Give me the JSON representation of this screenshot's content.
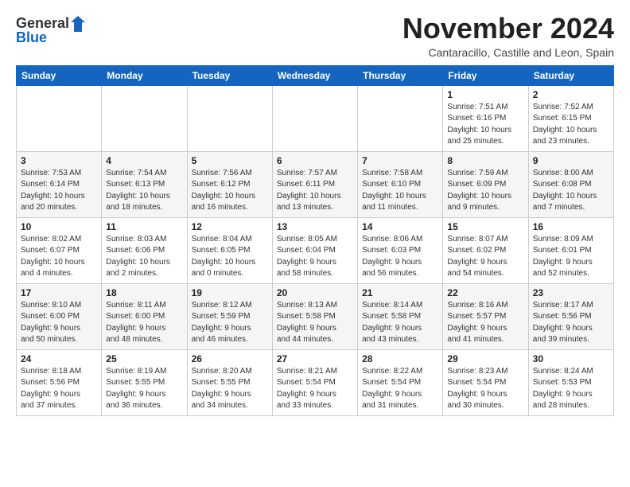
{
  "logo": {
    "general": "General",
    "blue": "Blue"
  },
  "header": {
    "month": "November 2024",
    "location": "Cantaracillo, Castille and Leon, Spain"
  },
  "weekdays": [
    "Sunday",
    "Monday",
    "Tuesday",
    "Wednesday",
    "Thursday",
    "Friday",
    "Saturday"
  ],
  "weeks": [
    [
      {
        "day": "",
        "info": ""
      },
      {
        "day": "",
        "info": ""
      },
      {
        "day": "",
        "info": ""
      },
      {
        "day": "",
        "info": ""
      },
      {
        "day": "",
        "info": ""
      },
      {
        "day": "1",
        "info": "Sunrise: 7:51 AM\nSunset: 6:16 PM\nDaylight: 10 hours\nand 25 minutes."
      },
      {
        "day": "2",
        "info": "Sunrise: 7:52 AM\nSunset: 6:15 PM\nDaylight: 10 hours\nand 23 minutes."
      }
    ],
    [
      {
        "day": "3",
        "info": "Sunrise: 7:53 AM\nSunset: 6:14 PM\nDaylight: 10 hours\nand 20 minutes."
      },
      {
        "day": "4",
        "info": "Sunrise: 7:54 AM\nSunset: 6:13 PM\nDaylight: 10 hours\nand 18 minutes."
      },
      {
        "day": "5",
        "info": "Sunrise: 7:56 AM\nSunset: 6:12 PM\nDaylight: 10 hours\nand 16 minutes."
      },
      {
        "day": "6",
        "info": "Sunrise: 7:57 AM\nSunset: 6:11 PM\nDaylight: 10 hours\nand 13 minutes."
      },
      {
        "day": "7",
        "info": "Sunrise: 7:58 AM\nSunset: 6:10 PM\nDaylight: 10 hours\nand 11 minutes."
      },
      {
        "day": "8",
        "info": "Sunrise: 7:59 AM\nSunset: 6:09 PM\nDaylight: 10 hours\nand 9 minutes."
      },
      {
        "day": "9",
        "info": "Sunrise: 8:00 AM\nSunset: 6:08 PM\nDaylight: 10 hours\nand 7 minutes."
      }
    ],
    [
      {
        "day": "10",
        "info": "Sunrise: 8:02 AM\nSunset: 6:07 PM\nDaylight: 10 hours\nand 4 minutes."
      },
      {
        "day": "11",
        "info": "Sunrise: 8:03 AM\nSunset: 6:06 PM\nDaylight: 10 hours\nand 2 minutes."
      },
      {
        "day": "12",
        "info": "Sunrise: 8:04 AM\nSunset: 6:05 PM\nDaylight: 10 hours\nand 0 minutes."
      },
      {
        "day": "13",
        "info": "Sunrise: 8:05 AM\nSunset: 6:04 PM\nDaylight: 9 hours\nand 58 minutes."
      },
      {
        "day": "14",
        "info": "Sunrise: 8:06 AM\nSunset: 6:03 PM\nDaylight: 9 hours\nand 56 minutes."
      },
      {
        "day": "15",
        "info": "Sunrise: 8:07 AM\nSunset: 6:02 PM\nDaylight: 9 hours\nand 54 minutes."
      },
      {
        "day": "16",
        "info": "Sunrise: 8:09 AM\nSunset: 6:01 PM\nDaylight: 9 hours\nand 52 minutes."
      }
    ],
    [
      {
        "day": "17",
        "info": "Sunrise: 8:10 AM\nSunset: 6:00 PM\nDaylight: 9 hours\nand 50 minutes."
      },
      {
        "day": "18",
        "info": "Sunrise: 8:11 AM\nSunset: 6:00 PM\nDaylight: 9 hours\nand 48 minutes."
      },
      {
        "day": "19",
        "info": "Sunrise: 8:12 AM\nSunset: 5:59 PM\nDaylight: 9 hours\nand 46 minutes."
      },
      {
        "day": "20",
        "info": "Sunrise: 8:13 AM\nSunset: 5:58 PM\nDaylight: 9 hours\nand 44 minutes."
      },
      {
        "day": "21",
        "info": "Sunrise: 8:14 AM\nSunset: 5:58 PM\nDaylight: 9 hours\nand 43 minutes."
      },
      {
        "day": "22",
        "info": "Sunrise: 8:16 AM\nSunset: 5:57 PM\nDaylight: 9 hours\nand 41 minutes."
      },
      {
        "day": "23",
        "info": "Sunrise: 8:17 AM\nSunset: 5:56 PM\nDaylight: 9 hours\nand 39 minutes."
      }
    ],
    [
      {
        "day": "24",
        "info": "Sunrise: 8:18 AM\nSunset: 5:56 PM\nDaylight: 9 hours\nand 37 minutes."
      },
      {
        "day": "25",
        "info": "Sunrise: 8:19 AM\nSunset: 5:55 PM\nDaylight: 9 hours\nand 36 minutes."
      },
      {
        "day": "26",
        "info": "Sunrise: 8:20 AM\nSunset: 5:55 PM\nDaylight: 9 hours\nand 34 minutes."
      },
      {
        "day": "27",
        "info": "Sunrise: 8:21 AM\nSunset: 5:54 PM\nDaylight: 9 hours\nand 33 minutes."
      },
      {
        "day": "28",
        "info": "Sunrise: 8:22 AM\nSunset: 5:54 PM\nDaylight: 9 hours\nand 31 minutes."
      },
      {
        "day": "29",
        "info": "Sunrise: 8:23 AM\nSunset: 5:54 PM\nDaylight: 9 hours\nand 30 minutes."
      },
      {
        "day": "30",
        "info": "Sunrise: 8:24 AM\nSunset: 5:53 PM\nDaylight: 9 hours\nand 28 minutes."
      }
    ]
  ]
}
